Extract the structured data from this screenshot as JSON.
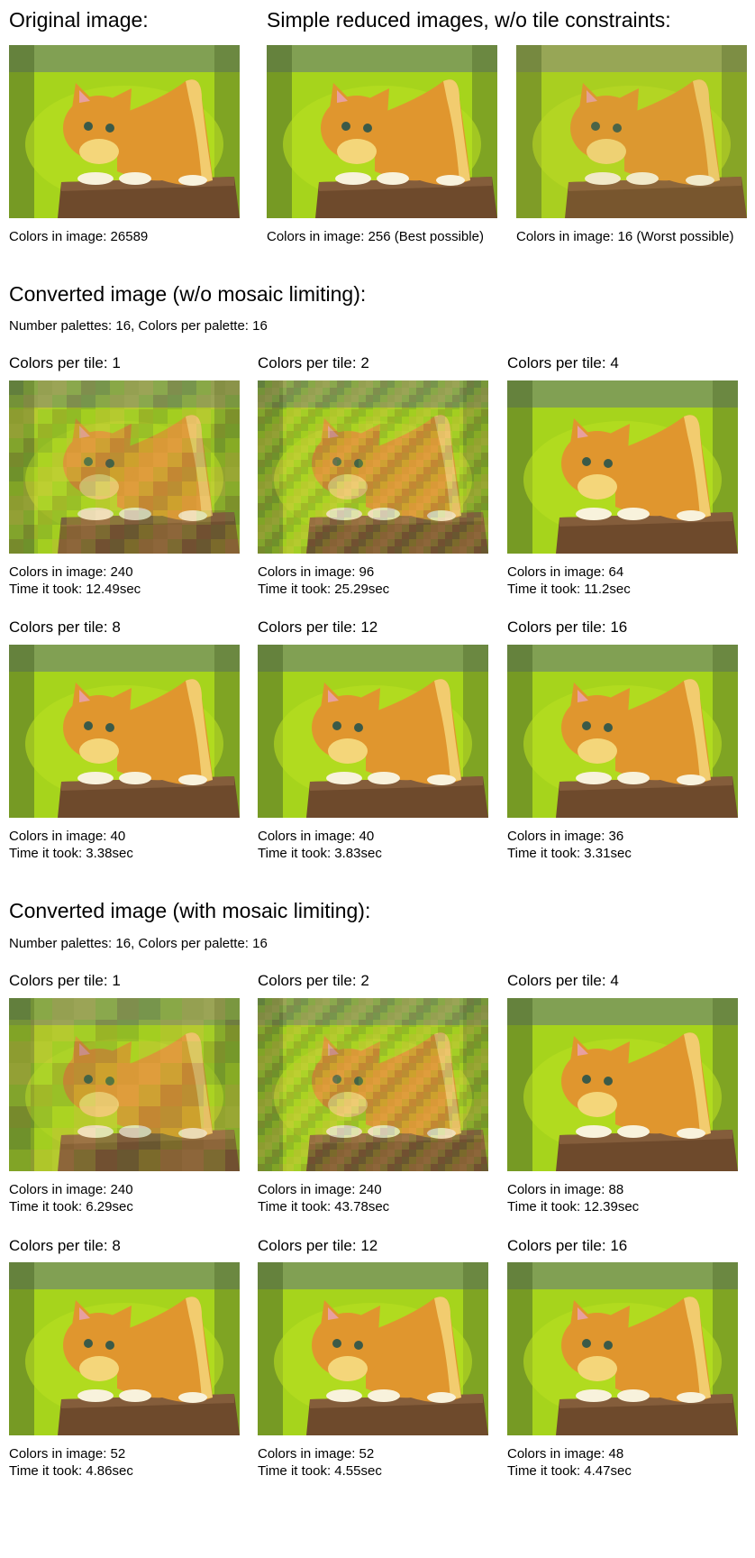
{
  "header": {
    "original_title": "Original image:",
    "simple_title": "Simple reduced images, w/o tile constraints:"
  },
  "top": {
    "original_caption": "Colors in image: 26589",
    "best_caption": "Colors in image: 256 (Best possible)",
    "worst_caption": "Colors in image: 16 (Worst possible)"
  },
  "sections": [
    {
      "title": "Converted image (w/o mosaic limiting):",
      "subtitle": "Number palettes: 16,  Colors per palette: 16",
      "items": [
        {
          "label": "Colors per tile: 1",
          "colors": "Colors in image: 240",
          "time": "Time it took: 12.49sec"
        },
        {
          "label": "Colors per tile: 2",
          "colors": "Colors in image: 96",
          "time": "Time it took: 25.29sec"
        },
        {
          "label": "Colors per tile: 4",
          "colors": "Colors in image: 64",
          "time": "Time it took: 11.2sec"
        },
        {
          "label": "Colors per tile: 8",
          "colors": "Colors in image: 40",
          "time": "Time it took: 3.38sec"
        },
        {
          "label": "Colors per tile: 12",
          "colors": "Colors in image: 40",
          "time": "Time it took: 3.83sec"
        },
        {
          "label": "Colors per tile: 16",
          "colors": "Colors in image: 36",
          "time": "Time it took: 3.31sec"
        }
      ]
    },
    {
      "title": "Converted image (with mosaic limiting):",
      "subtitle": "Number palettes: 16,  Colors per palette: 16",
      "items": [
        {
          "label": "Colors per tile: 1",
          "colors": "Colors in image: 240",
          "time": "Time it took: 6.29sec"
        },
        {
          "label": "Colors per tile: 2",
          "colors": "Colors in image: 240",
          "time": "Time it took: 43.78sec"
        },
        {
          "label": "Colors per tile: 4",
          "colors": "Colors in image: 88",
          "time": "Time it took: 12.39sec"
        },
        {
          "label": "Colors per tile: 8",
          "colors": "Colors in image: 52",
          "time": "Time it took: 4.86sec"
        },
        {
          "label": "Colors per tile: 12",
          "colors": "Colors in image: 52",
          "time": "Time it took: 4.55sec"
        },
        {
          "label": "Colors per tile: 16",
          "colors": "Colors in image: 48",
          "time": "Time it took: 4.47sec"
        }
      ]
    }
  ],
  "palette": {
    "background_green": "#a6d41c",
    "dark_green": "#4f6a2c",
    "kitten_orange": "#e0962e",
    "kitten_light": "#f4d67a",
    "stump_brown": "#6e4a2c"
  }
}
